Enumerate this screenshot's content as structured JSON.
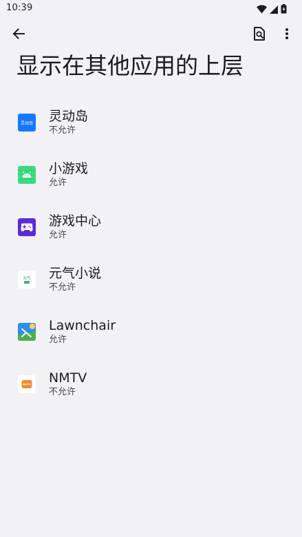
{
  "status_bar": {
    "time": "10:39"
  },
  "toolbar": {
    "back_icon": "arrow-back-icon",
    "search_icon": "search-document-icon",
    "more_icon": "more-vert-icon"
  },
  "page": {
    "title": "显示在其他应用的上层"
  },
  "apps": [
    {
      "name": "灵动岛",
      "status": "不允许",
      "icon": "dynamic-island-app-icon",
      "icon_label": "灵动岛"
    },
    {
      "name": "小游戏",
      "status": "允许",
      "icon": "android-app-icon"
    },
    {
      "name": "游戏中心",
      "status": "允许",
      "icon": "game-controller-app-icon"
    },
    {
      "name": "元气小说",
      "status": "不允许",
      "icon": "novel-app-icon",
      "icon_label": "元气"
    },
    {
      "name": "Lawnchair",
      "status": "允许",
      "icon": "lawnchair-app-icon"
    },
    {
      "name": "NMTV",
      "status": "不允许",
      "icon": "nmtv-app-icon",
      "icon_label": "NMTV"
    }
  ],
  "colors": {
    "background": "#f2f1f6",
    "text_primary": "#1c1b1f",
    "text_secondary": "#49454f"
  }
}
